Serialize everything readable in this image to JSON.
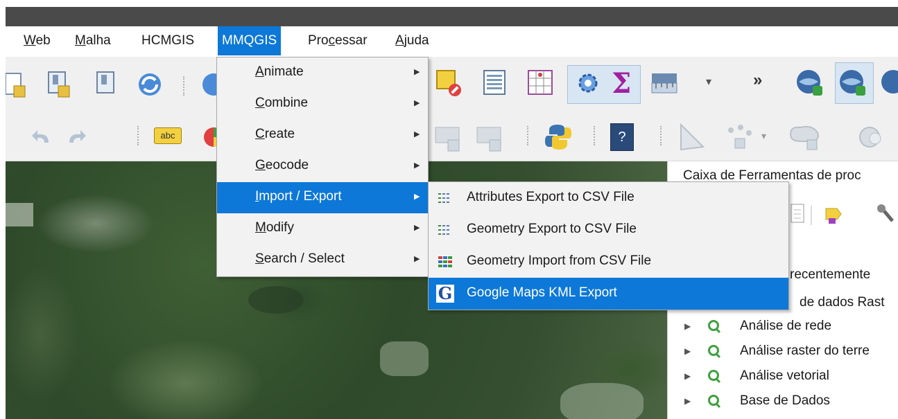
{
  "menubar": {
    "items": [
      {
        "label": "Web",
        "mnemonic_index": 0
      },
      {
        "label": "Malha",
        "mnemonic_index": 0
      },
      {
        "label": "HCMGIS",
        "mnemonic_index": -1
      },
      {
        "label": "MMQGIS",
        "mnemonic_index": -1,
        "active": true
      },
      {
        "label": "Processar",
        "mnemonic_index": 3
      },
      {
        "label": "Ajuda",
        "mnemonic_index": 0
      }
    ]
  },
  "mmqgis_menu": {
    "items": [
      {
        "label": "Animate",
        "has_submenu": true
      },
      {
        "label": "Combine",
        "has_submenu": true
      },
      {
        "label": "Create",
        "has_submenu": true
      },
      {
        "label": "Geocode",
        "has_submenu": true
      },
      {
        "label": "Import / Export",
        "has_submenu": true,
        "highlighted": true
      },
      {
        "label": "Modify",
        "has_submenu": true
      },
      {
        "label": "Search / Select",
        "has_submenu": true
      }
    ]
  },
  "import_export_submenu": {
    "items": [
      {
        "label": "Attributes Export to CSV File",
        "icon": "csv-table-icon"
      },
      {
        "label": "Geometry Export to CSV File",
        "icon": "csv-table-icon"
      },
      {
        "label": "Geometry Import from CSV File",
        "icon": "csv-import-icon"
      },
      {
        "label": "Google Maps KML Export",
        "icon": "google-g-icon",
        "highlighted": true
      }
    ]
  },
  "toolbar": {
    "overflow_label": "»",
    "abc_label": "abc",
    "help_label": "?"
  },
  "processing_toolbox": {
    "title": "Caixa de Ferramentas de proc",
    "recent_partial": "recentemente",
    "raster_partial": "de dados Rast",
    "groups": [
      {
        "label": "Análise de rede"
      },
      {
        "label": "Análise raster do terre"
      },
      {
        "label": "Análise vetorial"
      },
      {
        "label": "Base de Dados"
      }
    ]
  },
  "colors": {
    "highlight": "#0d78d8",
    "menu_bg": "#f2f2f2",
    "titlebar": "#4a4a4a"
  }
}
